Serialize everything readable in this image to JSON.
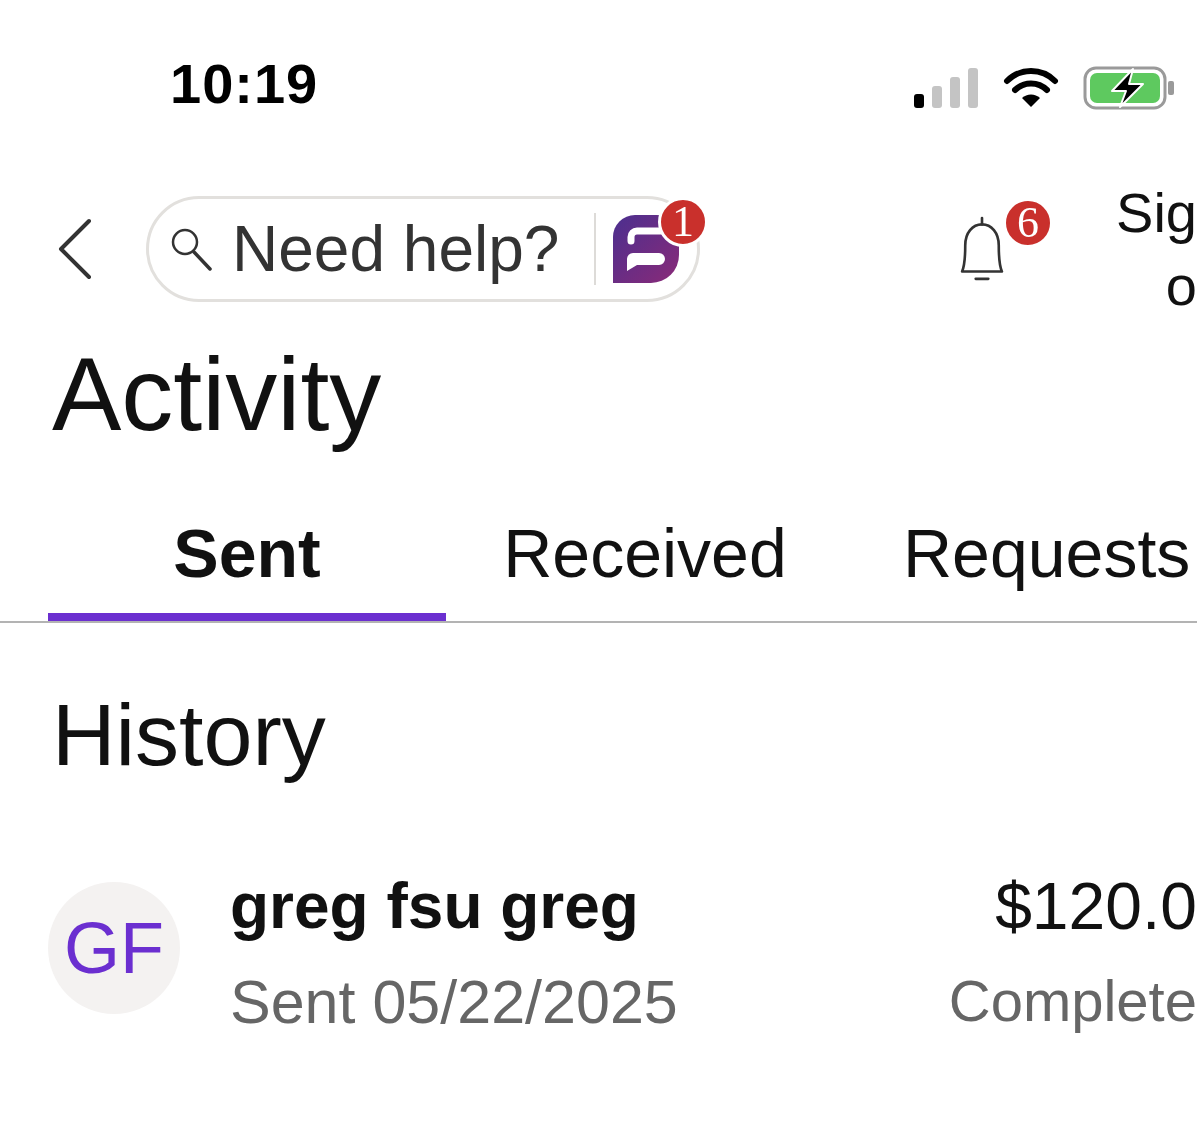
{
  "status_bar": {
    "time": "10:19"
  },
  "header": {
    "search": {
      "placeholder": "Need help?"
    },
    "chat_badge": "1",
    "notification_badge": "6",
    "link": {
      "lines": [
        "Sig",
        "o"
      ]
    }
  },
  "title": "Activity",
  "tabs": [
    {
      "label": "Sent",
      "selected": true
    },
    {
      "label": "Received",
      "selected": false
    },
    {
      "label": "Requests",
      "selected": false
    }
  ],
  "history": {
    "title": "History",
    "items": [
      {
        "initials": "GF",
        "name": "greg fsu greg",
        "detail": "Sent 05/22/2025",
        "amount": "$120.0",
        "status": "Complete"
      }
    ]
  }
}
